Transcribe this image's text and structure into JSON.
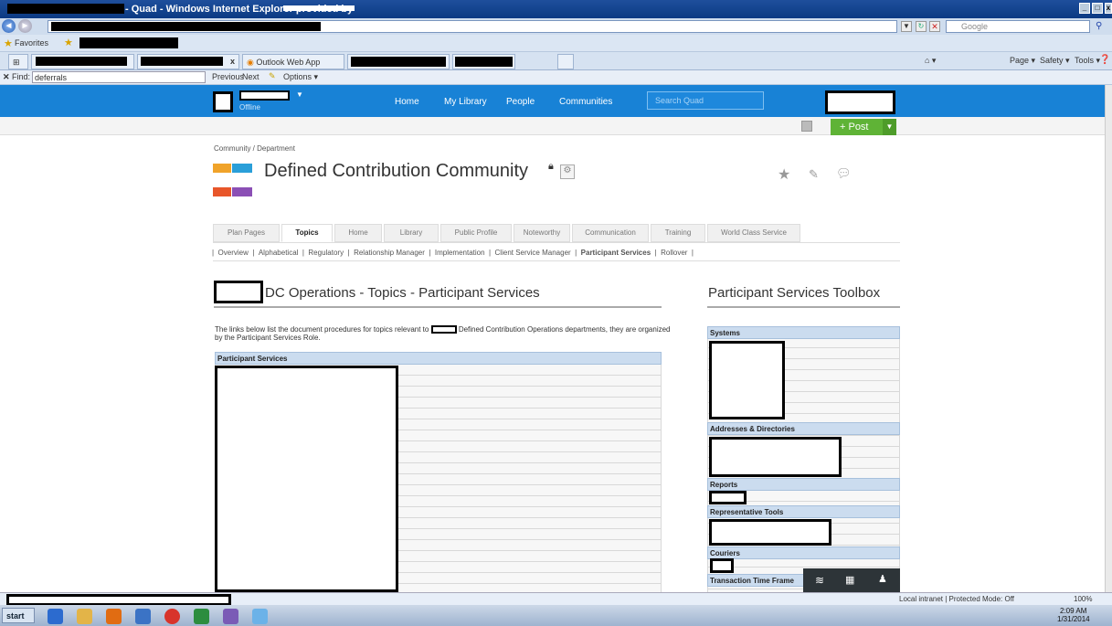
{
  "window": {
    "title": "- Quad - Windows Internet Explorer provided by"
  },
  "browser": {
    "search_placeholder": "Google",
    "favorites_label": "Favorites",
    "tabs": [
      {
        "label": "Outlook Web App"
      }
    ],
    "toolbar": {
      "page": "Page ▾",
      "safety": "Safety ▾",
      "tools": "Tools ▾"
    },
    "find": {
      "label": "Find:",
      "value": "deferrals",
      "previous": "Previous",
      "next": "Next",
      "options": "Options ▾"
    }
  },
  "site": {
    "status": "Offline",
    "nav": [
      "Home",
      "My Library",
      "People",
      "Communities"
    ],
    "search_placeholder": "Search Quad",
    "post_label": "+ Post"
  },
  "page": {
    "breadcrumb": "Community / Department",
    "title": "Defined Contribution Community",
    "tabs": [
      "Plan Pages",
      "Topics",
      "Home",
      "Library",
      "Public Profile",
      "Noteworthy",
      "Communication",
      "Training",
      "World Class Service"
    ],
    "active_tab": "Topics",
    "subnav": [
      "Overview",
      "Alphabetical",
      "Regulatory",
      "Relationship Manager",
      "Implementation",
      "Client Service Manager",
      "Participant Services",
      "Rollover"
    ],
    "heading": "DC Operations - Topics - Participant Services",
    "intro_pre": "The links below list the document procedures for topics relevant to",
    "intro_post": "Defined Contribution Operations departments, they are organized",
    "intro_line2": "by the Participant Services Role.",
    "table_header": "Participant Services"
  },
  "toolbox": {
    "title": "Participant Services Toolbox",
    "sections": [
      "Systems",
      "Addresses & Directories",
      "Reports",
      "Representative Tools",
      "Couriers",
      "Transaction Time Frame"
    ]
  },
  "statusbar": {
    "zone": "Local intranet | Protected Mode: Off",
    "zoom": "100%"
  },
  "taskbar": {
    "start": "start",
    "time": "2:09 AM",
    "date": "1/31/2014"
  },
  "colors": {
    "site_blue": "#1882d6",
    "post_green": "#5fb336",
    "table_header": "#cbdcef"
  }
}
